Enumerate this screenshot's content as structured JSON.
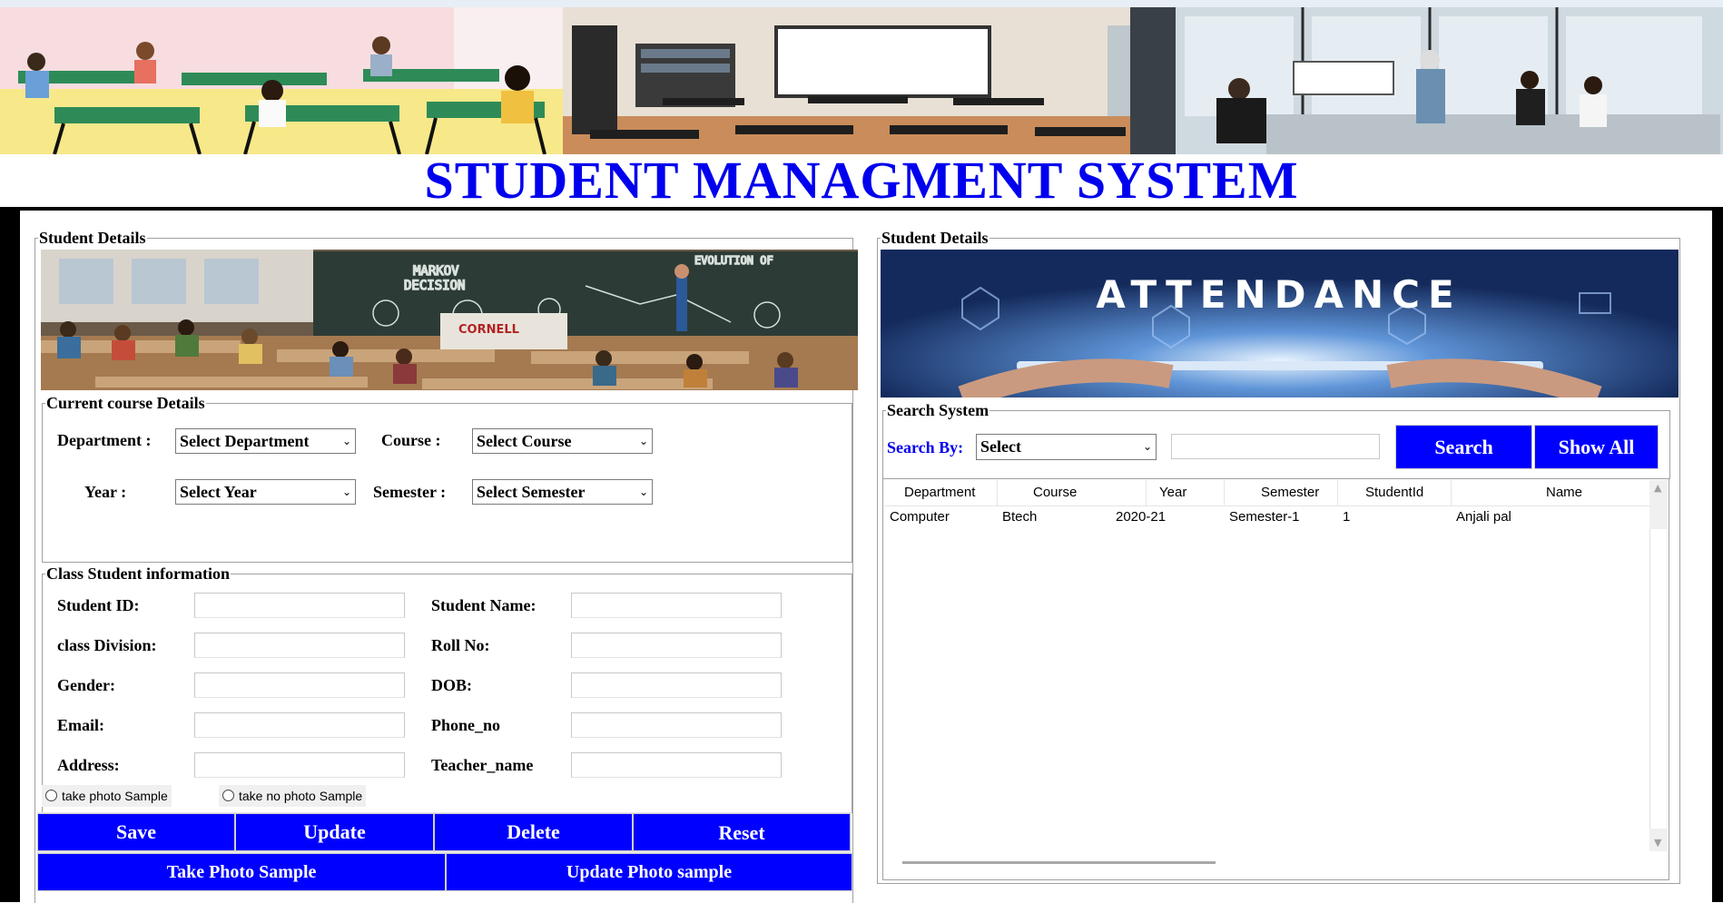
{
  "app": {
    "title": "STUDENT MANAGMENT SYSTEM"
  },
  "left_panel": {
    "legend": "Student Details",
    "course_section": {
      "legend": "Current course Details",
      "department_label": "Department :",
      "department_value": "Select Department",
      "course_label": "Course :",
      "course_value": "Select Course",
      "year_label": "Year :",
      "year_value": "Select Year",
      "semester_label": "Semester :",
      "semester_value": "Select Semester"
    },
    "class_section": {
      "legend": "Class Student information",
      "student_id_label": "Student ID:",
      "student_name_label": "Student Name:",
      "class_division_label": "class Division:",
      "roll_no_label": "Roll No:",
      "gender_label": "Gender:",
      "dob_label": "DOB:",
      "email_label": "Email:",
      "phone_label": "Phone_no",
      "address_label": "Address:",
      "teacher_label": "Teacher_name",
      "radio_photo": "take photo Sample",
      "radio_no_photo": "take no photo Sample"
    },
    "buttons": {
      "save": "Save",
      "update": "Update",
      "delete": "Delete",
      "reset": "Reset",
      "take_photo": "Take Photo Sample",
      "update_photo": "Update Photo sample"
    }
  },
  "right_panel": {
    "legend": "Student Details",
    "attendance_banner_text": "ATTENDANCE",
    "search": {
      "legend": "Search System",
      "search_by_label": "Search By:",
      "search_by_value": "Select",
      "search_button": "Search",
      "show_all_button": "Show All"
    },
    "table": {
      "columns": [
        "Department",
        "Course",
        "Year",
        "Semester",
        "StudentId",
        "Name"
      ],
      "rows": [
        [
          "Computer",
          "Btech",
          "2020-21",
          "Semester-1",
          "1",
          "Anjali pal"
        ]
      ]
    }
  },
  "colors": {
    "title": "#0000ee",
    "button_bg": "#0000ff",
    "button_text": "#ffffff",
    "search_by_label": "#0000ee"
  }
}
